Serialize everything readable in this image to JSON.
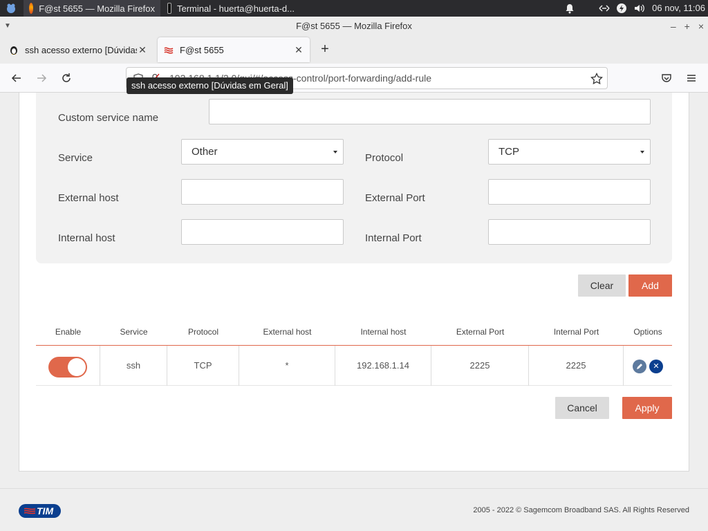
{
  "taskbar": {
    "tasks": [
      {
        "label": "F@st 5655 — Mozilla Firefox",
        "active": true
      },
      {
        "label": "Terminal - huerta@huerta-d...",
        "active": false
      }
    ],
    "clock": "06 nov, 11:06"
  },
  "window": {
    "title": "F@st 5655 — Mozilla Firefox"
  },
  "tabs": [
    {
      "label": "ssh acesso externo [Dúvidas",
      "active": false
    },
    {
      "label": "F@st 5655",
      "active": true
    }
  ],
  "url": "192.168.1.1/2.0/gui/#/access-control/port-forwarding/add-rule",
  "tooltip": "ssh acesso externo [Dúvidas em Geral]",
  "form": {
    "custom_service_label": "Custom service name",
    "custom_service_value": "",
    "service_label": "Service",
    "service_value": "Other",
    "protocol_label": "Protocol",
    "protocol_value": "TCP",
    "external_host_label": "External host",
    "external_host_value": "",
    "external_port_label": "External Port",
    "external_port_value": "",
    "internal_host_label": "Internal host",
    "internal_host_value": "",
    "internal_port_label": "Internal Port",
    "internal_port_value": "",
    "clear_label": "Clear",
    "add_label": "Add"
  },
  "table": {
    "headers": [
      "Enable",
      "Service",
      "Protocol",
      "External host",
      "Internal host",
      "External Port",
      "Internal Port",
      "Options"
    ],
    "rows": [
      {
        "enabled": true,
        "service": "ssh",
        "protocol": "TCP",
        "external_host": "*",
        "internal_host": "192.168.1.14",
        "external_port": "2225",
        "internal_port": "2225"
      }
    ]
  },
  "actions": {
    "cancel_label": "Cancel",
    "apply_label": "Apply"
  },
  "footer": {
    "logo_text": "TIM",
    "copyright": "2005 - 2022 © Sagemcom Broadband SAS. All Rights Reserved"
  },
  "colors": {
    "accent": "#e0684b",
    "edit_button": "#5d7a9e",
    "delete_button": "#0b3f8f"
  }
}
